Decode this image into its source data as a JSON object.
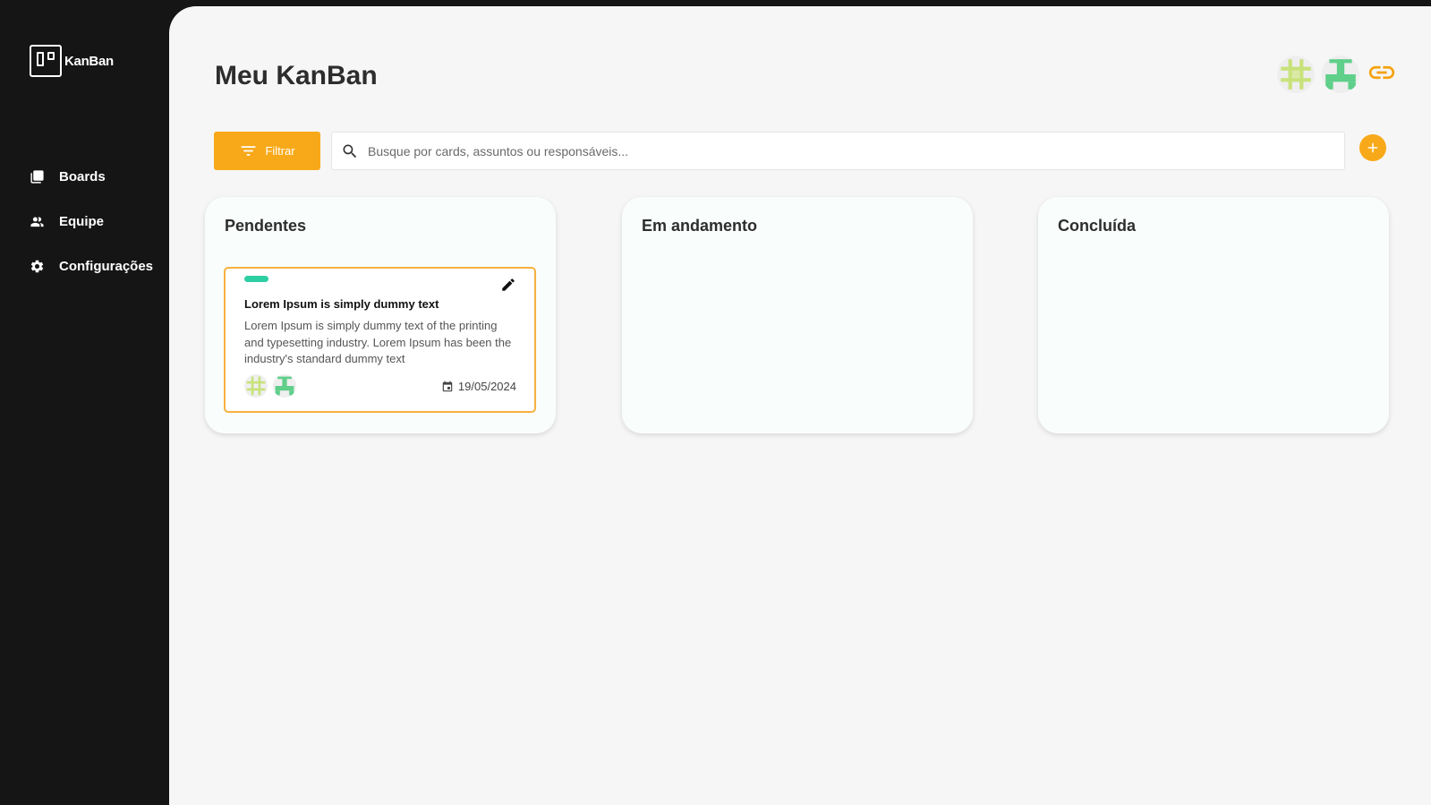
{
  "app": {
    "logo_text": "KanBan"
  },
  "sidebar": {
    "items": [
      {
        "label": "Boards",
        "icon": "boards-icon"
      },
      {
        "label": "Equipe",
        "icon": "team-icon"
      },
      {
        "label": "Configurações",
        "icon": "gear-icon"
      }
    ]
  },
  "header": {
    "title": "Meu KanBan",
    "avatars": [
      "yellow-green-pattern-avatar",
      "green-pattern-avatar"
    ],
    "share_icon": "link-icon"
  },
  "toolbar": {
    "filter_label": "Filtrar",
    "search_placeholder": "Busque por cards, assuntos ou responsáveis...",
    "add_icon": "plus-icon"
  },
  "columns": [
    {
      "title": "Pendentes",
      "cards": [
        {
          "tag_color": "#2dcfa3",
          "title": "Lorem Ipsum is simply dummy text",
          "description": "Lorem Ipsum is simply dummy text of the printing and typesetting industry. Lorem Ipsum has been the industry's standard dummy text",
          "date": "19/05/2024"
        }
      ]
    },
    {
      "title": "Em andamento",
      "cards": []
    },
    {
      "title": "Concluída",
      "cards": []
    }
  ],
  "colors": {
    "accent": "#f8a919",
    "sidebar_bg": "#151515",
    "main_bg": "#f6f6f6",
    "tag": "#2dcfa3"
  }
}
